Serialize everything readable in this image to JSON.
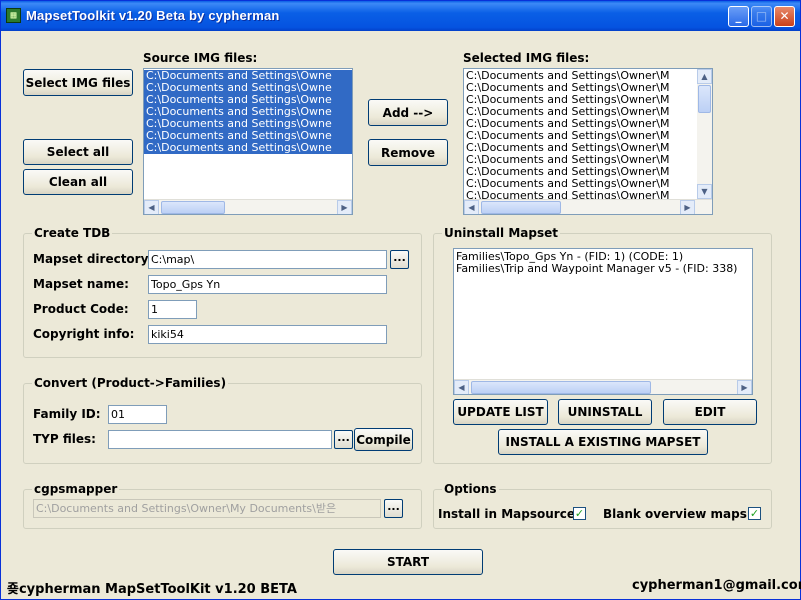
{
  "window": {
    "title": "MapsetToolkit v1.20 Beta by cypherman",
    "icon_glyph": "▦"
  },
  "source_files": {
    "label": "Source IMG files:",
    "items": [
      "C:\\Documents and Settings\\Owne",
      "C:\\Documents and Settings\\Owne",
      "C:\\Documents and Settings\\Owne",
      "C:\\Documents and Settings\\Owne",
      "C:\\Documents and Settings\\Owne",
      "C:\\Documents and Settings\\Owne",
      "C:\\Documents and Settings\\Owne"
    ]
  },
  "selected_files": {
    "label": "Selected IMG files:",
    "items": [
      "C:\\Documents and Settings\\Owner\\M",
      "C:\\Documents and Settings\\Owner\\M",
      "C:\\Documents and Settings\\Owner\\M",
      "C:\\Documents and Settings\\Owner\\M",
      "C:\\Documents and Settings\\Owner\\M",
      "C:\\Documents and Settings\\Owner\\M",
      "C:\\Documents and Settings\\Owner\\M",
      "C:\\Documents and Settings\\Owner\\M",
      "C:\\Documents and Settings\\Owner\\M",
      "C:\\Documents and Settings\\Owner\\M",
      "C:\\Documents and Settings\\Owner\\M"
    ]
  },
  "buttons": {
    "select_img": "Select IMG files",
    "select_all": "Select all",
    "clean_all": "Clean all",
    "add": "Add -->",
    "remove": "Remove",
    "update_list": "UPDATE LIST",
    "uninstall": "UNINSTALL",
    "edit": "EDIT",
    "install_existing": "INSTALL A EXISTING MAPSET",
    "compile": "Compile",
    "browse": "...",
    "start": "START"
  },
  "create_tdb": {
    "title": "Create TDB",
    "mapset_dir_label": "Mapset directory:",
    "mapset_dir_value": "C:\\map\\",
    "mapset_name_label": "Mapset name:",
    "mapset_name_value": "Topo_Gps Yn",
    "product_code_label": "Product Code:",
    "product_code_value": "1",
    "copyright_label": "Copyright info:",
    "copyright_value": "kiki54"
  },
  "convert": {
    "title": "Convert (Product->Families)",
    "family_id_label": "Family ID:",
    "family_id_value": "01",
    "typ_label": "TYP files:",
    "typ_value": ""
  },
  "uninstall_mapset": {
    "title": "Uninstall Mapset",
    "items": [
      "Families\\Topo_Gps Yn - (FID: 1)   (CODE: 1)",
      "Families\\Trip and Waypoint Manager v5 - (FID: 338)"
    ]
  },
  "cgpsmapper": {
    "title": "cgpsmapper",
    "path": "C:\\Documents and Settings\\Owner\\My Documents\\받은"
  },
  "options": {
    "title": "Options",
    "install_in_mapsource_label": "Install in Mapsource:",
    "install_in_mapsource_checked": true,
    "blank_overview_label": "Blank overview maps:",
    "blank_overview_checked": true,
    "check_glyph": "✓"
  },
  "status": {
    "left": "cypherman MapSetToolKit v1.20 BETA",
    "left_glyph": "죶",
    "right": "cypherman1@gmail.com"
  },
  "icons": {
    "up": "▲",
    "down": "▼",
    "left": "◀",
    "right": "▶",
    "minimize": "_",
    "maximize": "□",
    "close": "✕"
  }
}
